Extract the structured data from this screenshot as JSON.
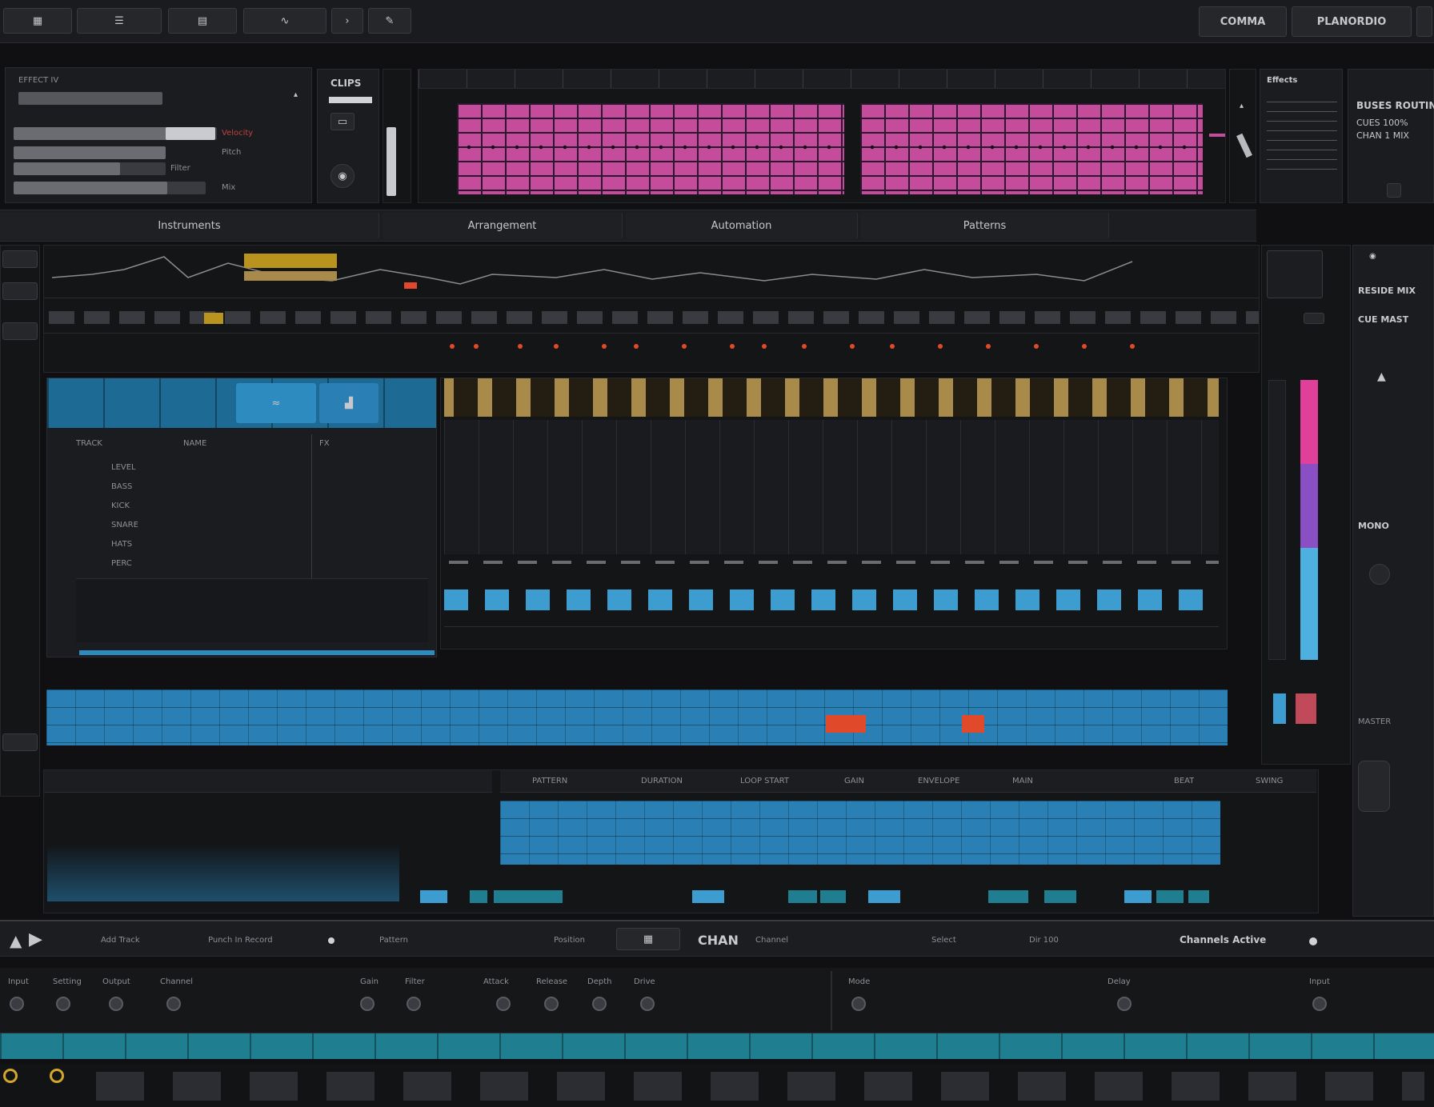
{
  "window": {
    "header_buttons": [
      "COMMA",
      "PLANORDIO"
    ]
  },
  "browser_panel": {
    "title": "EFFECT IV",
    "rows": [
      "Velocity",
      "Pitch",
      "Filter",
      "Mix"
    ]
  },
  "clip_panel": {
    "title": "CLIPS"
  },
  "top_right_panel": {
    "title": "Effects",
    "lines": [
      "BUSES ROUTING",
      "CUES 100%",
      "CHAN 1 MIX"
    ]
  },
  "section_bar": {
    "labels": [
      "Instruments",
      "Arrangement",
      "Automation",
      "Patterns"
    ]
  },
  "side_panel": {
    "labels": [
      "RESIDE MIX",
      "CUE MAST",
      "MONO",
      "MASTER"
    ]
  },
  "track_list": {
    "headers": [
      "TRACK",
      "NAME",
      "FX"
    ],
    "rows": [
      "LEVEL",
      "BASS",
      "KICK",
      "SNARE",
      "HATS",
      "PERC"
    ]
  },
  "bottom_editor": {
    "columns": [
      "PATTERN",
      "DURATION",
      "LOOP START",
      "GAIN",
      "ENVELOPE",
      "MAIN",
      "BEAT",
      "SWING"
    ]
  },
  "transport": {
    "items": [
      "Add Track",
      "Punch In Record",
      "Pattern",
      "Position",
      "Channel",
      "Select",
      "Dir 100",
      "Channels Active"
    ],
    "center": "CHAN"
  },
  "controls_bar": {
    "labels": [
      "Input",
      "Setting",
      "Output",
      "Channel",
      "Gain",
      "Filter",
      "Attack",
      "Release",
      "Depth",
      "Drive",
      "Mode",
      "Delay",
      "Input"
    ]
  },
  "colors": {
    "magenta": "#c44c9a",
    "gold": "#a88a4a",
    "blue": "#3d9dd0",
    "teal": "#1f7f91",
    "red": "#e04a2a"
  }
}
